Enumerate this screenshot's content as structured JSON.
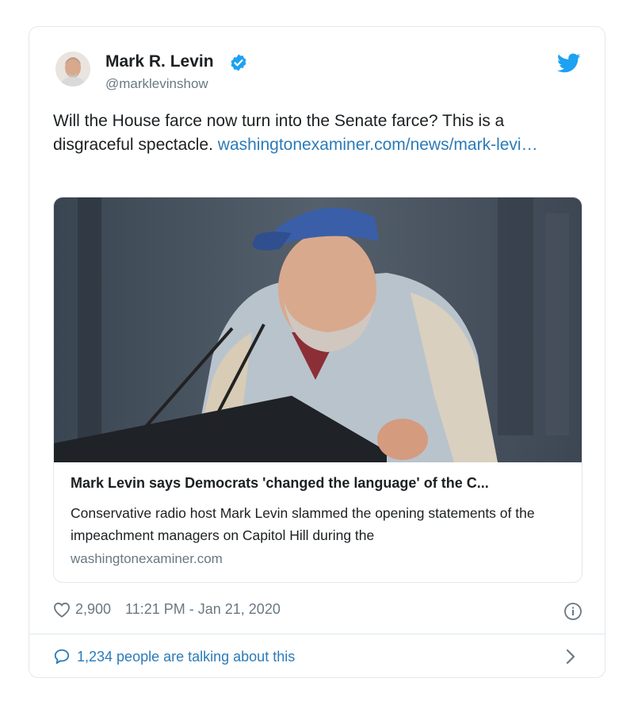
{
  "author": {
    "name": "Mark R. Levin",
    "handle": "@marklevinshow"
  },
  "tweet": {
    "text_before": "Will the House farce now turn into the Senate farce?  This is a disgraceful spectacle. ",
    "link": "washingtonexaminer.com/news/mark-levi…"
  },
  "link_card": {
    "title": "Mark Levin says Democrats 'changed the language' of the C...",
    "description": "Conservative radio host Mark Levin slammed the opening statements of the impeachment managers on Capitol Hill during the",
    "domain": "washingtonexaminer.com"
  },
  "meta": {
    "likes": "2,900",
    "timestamp": "11:21 PM - Jan 21, 2020"
  },
  "footer": {
    "talking": "1,234 people are talking about this"
  },
  "icons": {
    "verified": "verified-badge-icon",
    "bird": "twitter-bird-icon",
    "heart": "heart-icon",
    "info": "info-icon",
    "bubble": "speech-bubble-icon",
    "chevron": "chevron-right-icon"
  },
  "colors": {
    "link": "#2b7bb9",
    "muted": "#697882",
    "twitter_blue": "#1da1f2",
    "border": "#e1e8ed"
  }
}
